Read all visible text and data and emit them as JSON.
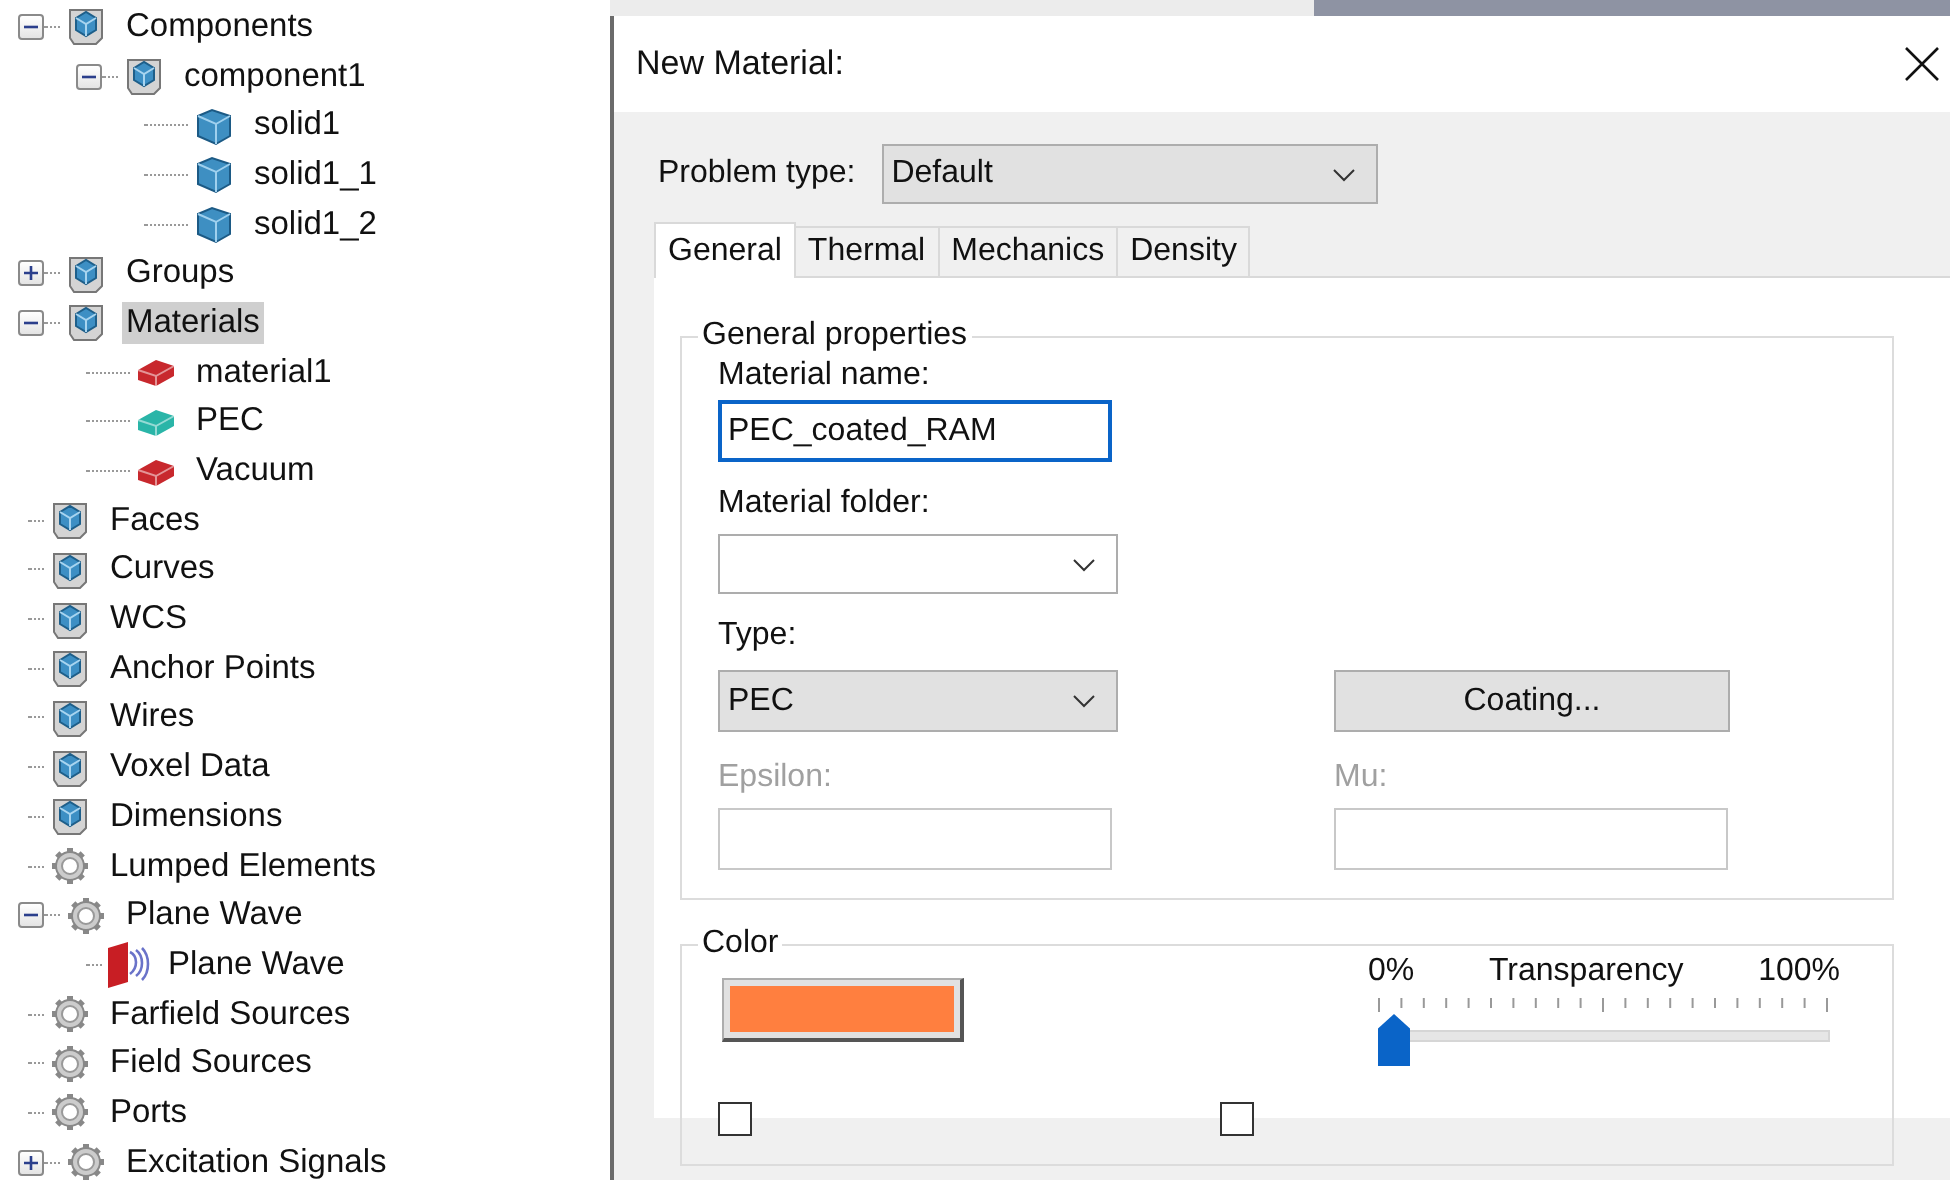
{
  "tree": [
    {
      "label": "Components",
      "kind": "folder",
      "expanded": true,
      "selected": false,
      "children": [
        {
          "label": "component1",
          "kind": "folder",
          "expanded": true,
          "selected": false,
          "children": [
            {
              "label": "solid1",
              "kind": "solid",
              "selected": false
            },
            {
              "label": "solid1_1",
              "kind": "solid",
              "selected": false
            },
            {
              "label": "solid1_2",
              "kind": "solid",
              "selected": false
            }
          ]
        }
      ]
    },
    {
      "label": "Groups",
      "kind": "folder",
      "expanded": false,
      "selected": false
    },
    {
      "label": "Materials",
      "kind": "folder",
      "expanded": true,
      "selected": true,
      "children": [
        {
          "label": "material1",
          "kind": "material",
          "color": "#c8282d",
          "selected": false
        },
        {
          "label": "PEC",
          "kind": "material",
          "color": "#2ab5a8",
          "selected": false
        },
        {
          "label": "Vacuum",
          "kind": "material",
          "color": "#c8282d",
          "selected": false
        }
      ]
    },
    {
      "label": "Faces",
      "kind": "folder",
      "selected": false
    },
    {
      "label": "Curves",
      "kind": "folder",
      "selected": false
    },
    {
      "label": "WCS",
      "kind": "folder",
      "selected": false
    },
    {
      "label": "Anchor Points",
      "kind": "folder",
      "selected": false
    },
    {
      "label": "Wires",
      "kind": "folder",
      "selected": false
    },
    {
      "label": "Voxel Data",
      "kind": "folder",
      "selected": false
    },
    {
      "label": "Dimensions",
      "kind": "folder",
      "selected": false
    },
    {
      "label": "Lumped Elements",
      "kind": "gear",
      "selected": false
    },
    {
      "label": "Plane Wave",
      "kind": "gear",
      "expanded": true,
      "selected": false,
      "children": [
        {
          "label": "Plane Wave",
          "kind": "planewave",
          "selected": false
        }
      ]
    },
    {
      "label": "Farfield Sources",
      "kind": "gear",
      "selected": false
    },
    {
      "label": "Field Sources",
      "kind": "gear",
      "selected": false
    },
    {
      "label": "Ports",
      "kind": "gear",
      "selected": false
    },
    {
      "label": "Excitation Signals",
      "kind": "gear",
      "expanded": false,
      "selected": false
    }
  ],
  "dialog": {
    "title": "New Material:",
    "problem_type": {
      "label": "Problem type:",
      "value": "Default"
    },
    "tabs": [
      {
        "label": "General",
        "selected": true
      },
      {
        "label": "Thermal",
        "selected": false
      },
      {
        "label": "Mechanics",
        "selected": false
      },
      {
        "label": "Density",
        "selected": false
      }
    ],
    "general_properties": {
      "title": "General properties",
      "material_name": {
        "label": "Material name:",
        "value": "PEC_coated_RAM"
      },
      "material_folder": {
        "label": "Material folder:"
      },
      "type": {
        "label": "Type:",
        "value": "PEC"
      },
      "coating_button": "Coating...",
      "epsilon": {
        "label": "Epsilon:",
        "disabled": true
      },
      "mu": {
        "label": "Mu:",
        "disabled": true
      }
    },
    "color": {
      "title": "Color",
      "transparency": {
        "min_label": "0%",
        "label": "Transparency",
        "max_label": "100%",
        "level": 0
      },
      "checkboxes": [
        {
          "checked": false
        },
        {
          "checked": false
        }
      ]
    }
  }
}
